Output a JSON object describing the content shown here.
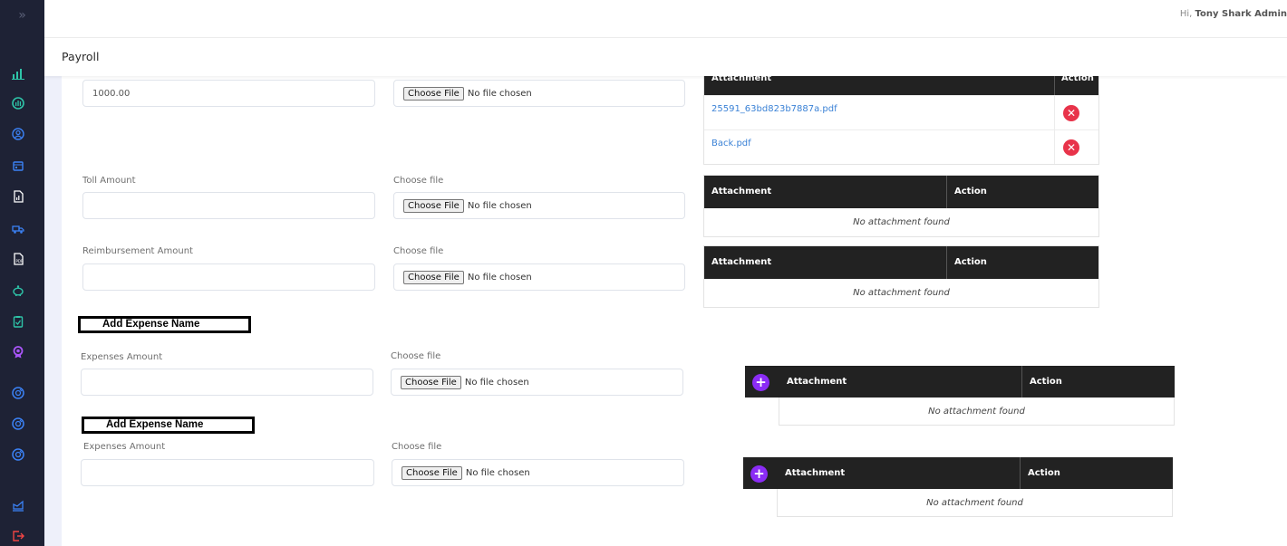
{
  "header": {
    "greeting_prefix": "Hi,",
    "user_name": "Tony Shark Admin"
  },
  "page": {
    "title": "Payroll"
  },
  "sidebar": {
    "toggle_icon": "double-chevron-right-icon",
    "items": [
      {
        "icon": "bar-chart-icon",
        "color": "#2ec4a8"
      },
      {
        "icon": "dashboard-gauge-icon",
        "color": "#2ec4a8"
      },
      {
        "icon": "user-circle-icon",
        "color": "#3b82f6"
      },
      {
        "icon": "calendar-icon",
        "color": "#3b82f6"
      },
      {
        "icon": "report-document-icon",
        "color": "#ffffff"
      },
      {
        "icon": "truck-icon",
        "color": "#3b82f6"
      },
      {
        "icon": "pdf-document-icon",
        "color": "#ffffff"
      },
      {
        "icon": "piggy-bank-icon",
        "color": "#2ec4a8"
      },
      {
        "icon": "clipboard-check-icon",
        "color": "#2ec4a8"
      },
      {
        "icon": "award-badge-icon",
        "color": "#a855f7"
      },
      {
        "icon": "disc-icon-1",
        "color": "#3b82f6"
      },
      {
        "icon": "disc-icon-2",
        "color": "#3b82f6"
      },
      {
        "icon": "disc-icon-3",
        "color": "#3b82f6"
      },
      {
        "icon": "analytics-icon",
        "color": "#3b82f6"
      },
      {
        "icon": "logout-icon",
        "color": "#ef4444"
      }
    ]
  },
  "form": {
    "top_amount_value": "1000.00",
    "file_button_label": "Choose File",
    "no_file_text": "No file chosen",
    "toll_label": "Toll Amount",
    "reimbursement_label": "Reimbursement Amount",
    "choose_file_label": "Choose file",
    "expense_name_label": "Add Expense Name",
    "expenses_amount_label": "Expenses Amount"
  },
  "tables": {
    "attachment_header": "Attachment",
    "action_header": "Action",
    "empty_text": "No attachment found",
    "files": [
      "25591_63bd823b7887a.pdf",
      "Back.pdf"
    ]
  },
  "colors": {
    "sidebar_bg": "#1e2235",
    "table_header_bg": "#222222",
    "link": "#3b82d6",
    "delete": "#e8334a",
    "add": "#8b2cf5"
  }
}
